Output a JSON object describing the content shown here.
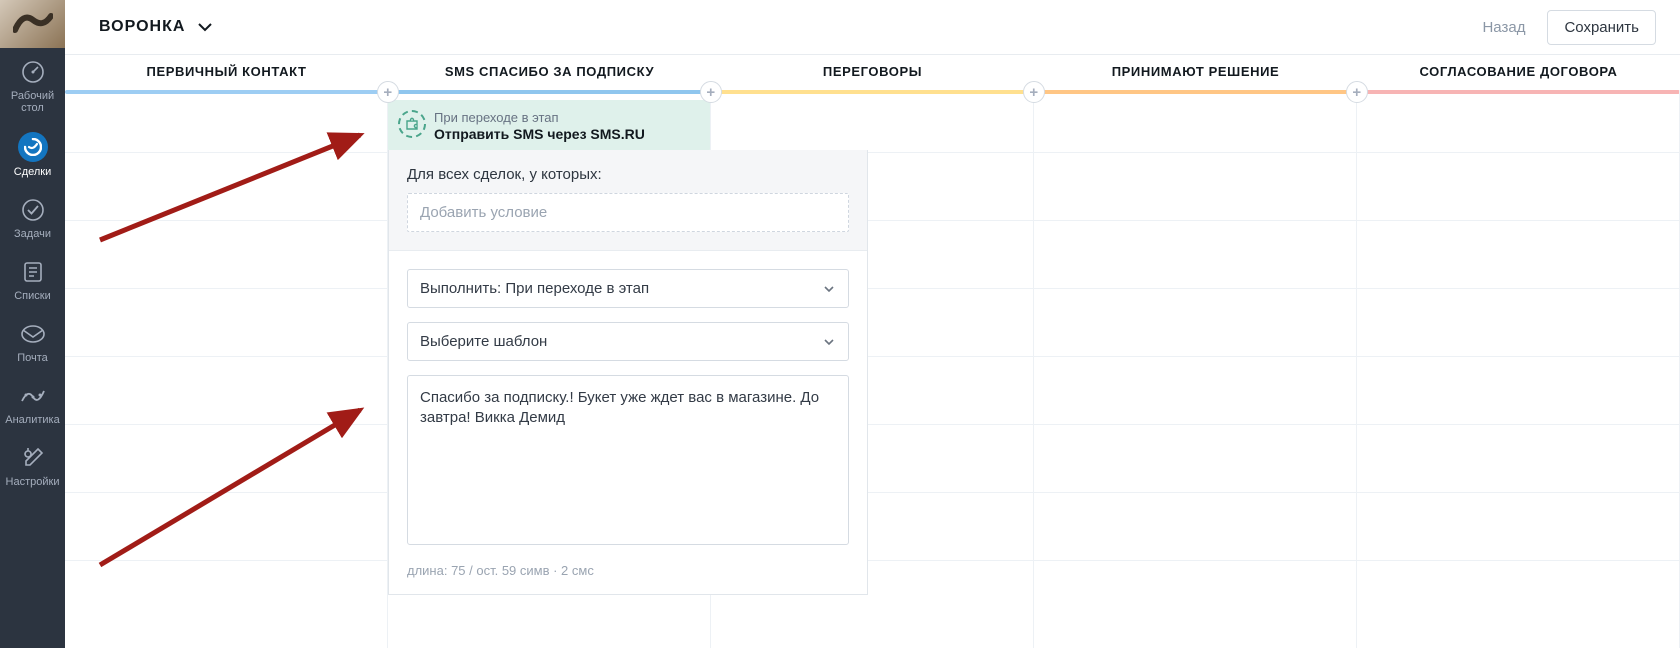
{
  "sidebar": {
    "items": [
      {
        "label": "Рабочий\nстол",
        "icon": "dashboard-icon"
      },
      {
        "label": "Сделки",
        "icon": "deals-icon",
        "active": true
      },
      {
        "label": "Задачи",
        "icon": "tasks-icon"
      },
      {
        "label": "Списки",
        "icon": "lists-icon"
      },
      {
        "label": "Почта",
        "icon": "mail-icon"
      },
      {
        "label": "Аналитика",
        "icon": "analytics-icon"
      },
      {
        "label": "Настройки",
        "icon": "settings-icon"
      }
    ]
  },
  "topbar": {
    "title": "ВОРОНКА",
    "back": "Назад",
    "save": "Сохранить"
  },
  "stages": [
    {
      "name": "ПЕРВИЧНЫЙ КОНТАКТ",
      "color": "#9dcdf3"
    },
    {
      "name": "SMS СПАСИБО ЗА ПОДПИСКУ",
      "color": "#8fc6ee"
    },
    {
      "name": "ПЕРЕГОВОРЫ",
      "color": "#ffe08f"
    },
    {
      "name": "ПРИНИМАЮТ РЕШЕНИЕ",
      "color": "#ffc685"
    },
    {
      "name": "СОГЛАСОВАНИЕ ДОГОВОРА",
      "color": "#f7b4b4"
    }
  ],
  "trigger": {
    "sub": "При переходе в этап",
    "main": "Отправить SMS через SMS.RU"
  },
  "config": {
    "cond_label": "Для всех сделок, у которых:",
    "cond_placeholder": "Добавить условие",
    "execute_select": "Выполнить: При переходе в этап",
    "template_select": "Выберите шаблон",
    "message": "Спасибо за подписку.! Букет уже ждет вас в магазине. До завтра! Викка Демид",
    "counter": "длина: 75 / ост. 59 симв · 2 смс"
  }
}
